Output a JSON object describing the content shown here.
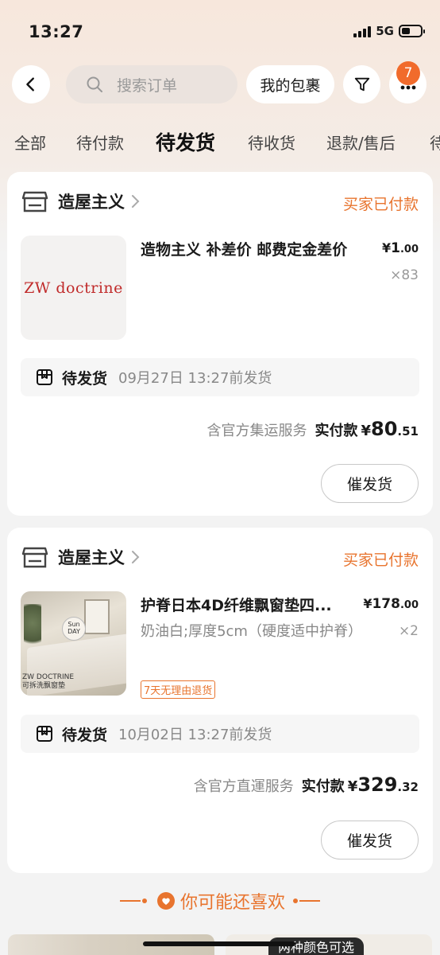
{
  "status_bar": {
    "time": "13:27",
    "network": "5G"
  },
  "header": {
    "search_placeholder": "搜索订单",
    "packages_label": "我的包裹",
    "notification_count": "7"
  },
  "tabs": [
    "全部",
    "待付款",
    "待发货",
    "待收货",
    "退款/售后",
    "待"
  ],
  "active_tab": "待发货",
  "orders": [
    {
      "shop": "造屋主义",
      "status": "买家已付款",
      "thumb_text": "ZW doctrine",
      "title": "造物主义 补差价 邮费定金差价",
      "price_currency": "¥",
      "price_int": "1",
      "price_dec": ".00",
      "qty": "×83",
      "ship_label": "待发货",
      "ship_time": "09月27日 13:27前发货",
      "service": "含官方集运服务",
      "paid_label": "实付款",
      "total_currency": "¥",
      "total_int": "80",
      "total_dec": ".51",
      "button": "催发货"
    },
    {
      "shop": "造屋主义",
      "status": "买家已付款",
      "thumb_card": "Sun DAY",
      "thumb_brand": "ZW DOCTRINE",
      "thumb_brand_sub": "可拆洗飘窗垫",
      "title": "护脊日本4D纤维飘窗垫四...",
      "price_currency": "¥",
      "price_int": "178",
      "price_dec": ".00",
      "qty": "×2",
      "sku": "奶油白;厚度5cm（硬度适中护脊）",
      "tag": "7天无理由退货",
      "ship_label": "待发货",
      "ship_time": "10月02日 13:27前发货",
      "service": "含官方直運服务",
      "paid_label": "实付款",
      "total_currency": "¥",
      "total_int": "329",
      "total_dec": ".32",
      "button": "催发货"
    }
  ],
  "recommend": {
    "title": "你可能还喜欢",
    "item_label": "两种颜色可选"
  },
  "colors": {
    "accent": "#e8742e",
    "badge": "#f16b2c"
  }
}
